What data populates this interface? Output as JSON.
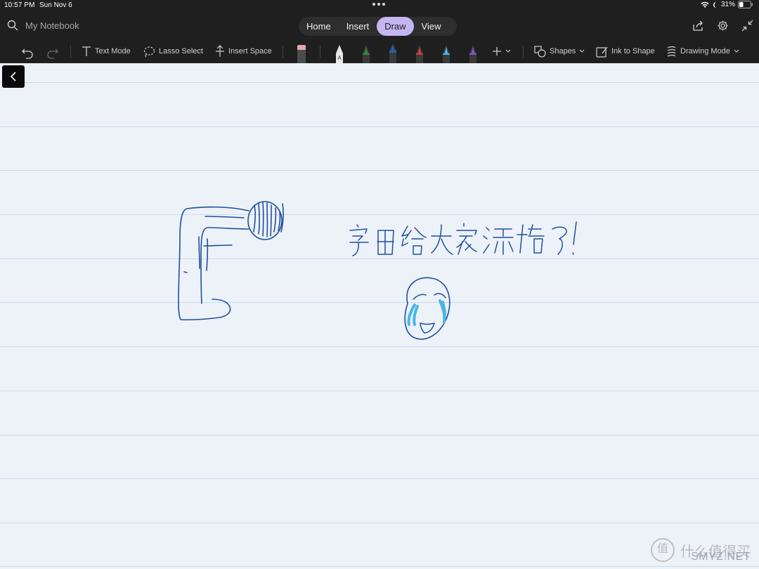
{
  "status": {
    "time": "10:57 PM",
    "date": "Sun Nov 6",
    "battery": "31%"
  },
  "notebook": {
    "title": "My Notebook"
  },
  "tabs": [
    {
      "label": "Home"
    },
    {
      "label": "Insert"
    },
    {
      "label": "Draw",
      "active": true
    },
    {
      "label": "View"
    }
  ],
  "draw_toolbar": {
    "text_mode": "Text Mode",
    "lasso_select": "Lasso Select",
    "insert_space": "Insert Space",
    "shapes": "Shapes",
    "ink_to_shape": "Ink to Shape",
    "drawing_mode": "Drawing Mode"
  },
  "pens": [
    {
      "name": "eraser",
      "color": "#e6a7b0"
    },
    {
      "name": "highlighter-white",
      "color": "#e9e9e9"
    },
    {
      "name": "pen-green",
      "color": "#2f8a3a"
    },
    {
      "name": "pen-blue",
      "color": "#2364b5"
    },
    {
      "name": "pen-red",
      "color": "#d43a3a"
    },
    {
      "name": "pen-light-blue",
      "color": "#45b7e8"
    },
    {
      "name": "pen-purple",
      "color": "#7b57c9"
    }
  ],
  "ink_color": "#1f4f9c",
  "watermark": {
    "glyph": "值",
    "text": "什么值得买",
    "sub": "SMYZ.NET"
  }
}
